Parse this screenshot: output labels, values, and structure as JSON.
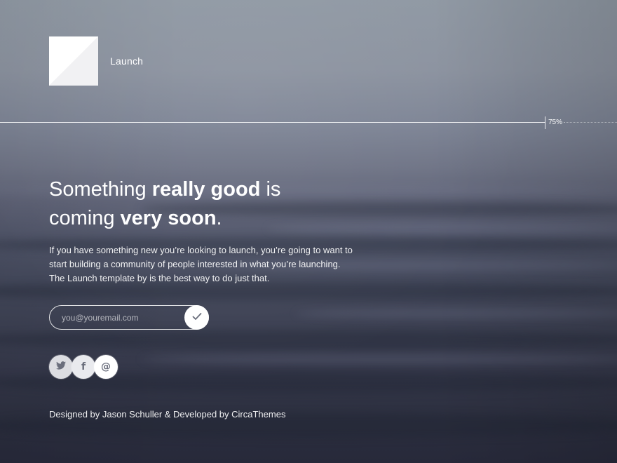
{
  "brand": {
    "name": "Launch",
    "logo_icon": "logo-icon"
  },
  "progress": {
    "label": "75%",
    "value": 0.75
  },
  "headline": {
    "part1": "Something ",
    "bold1": "really good",
    "part2": " is",
    "part3": "coming ",
    "bold2": "very soon",
    "part4": "."
  },
  "description": "If you have something new you’re looking to launch, you’re going to want to start building a community of people interested in what you’re launching. The Launch template by is the best way to do just that.",
  "signup": {
    "placeholder": "you@youremail.com",
    "value": "",
    "submit_icon": "checkmark-icon"
  },
  "social": [
    {
      "name": "twitter",
      "icon": "twitter-icon"
    },
    {
      "name": "facebook",
      "icon": "facebook-icon",
      "glyph": "f"
    },
    {
      "name": "email",
      "icon": "at-sign-icon",
      "glyph": "@"
    }
  ],
  "footer": {
    "credits": "Designed by Jason Schuller & Developed by CircaThemes"
  },
  "colors": {
    "text": "#ffffff",
    "button_icon": "#6a6e7c"
  }
}
